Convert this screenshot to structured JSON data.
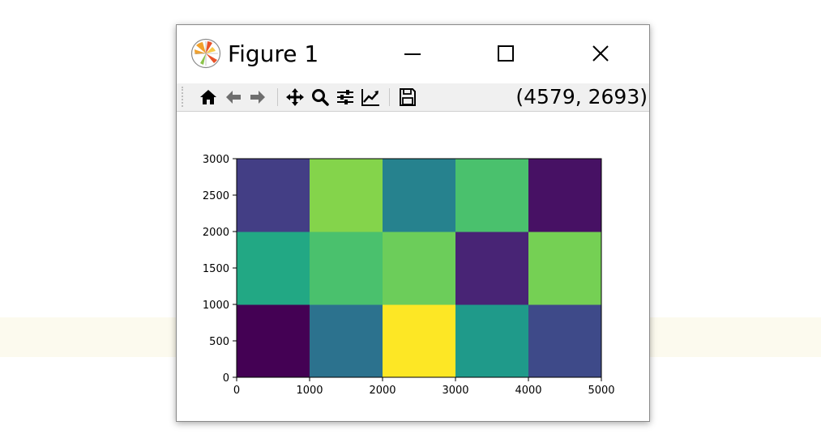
{
  "window": {
    "title": "Figure 1",
    "coordinate_readout": "(4579, 2693)"
  },
  "toolbar": {
    "buttons": [
      {
        "name": "home-icon"
      },
      {
        "name": "back-arrow-icon"
      },
      {
        "name": "forward-arrow-icon"
      },
      {
        "name": "pan-move-icon"
      },
      {
        "name": "zoom-magnifier-icon"
      },
      {
        "name": "subplots-configure-icon"
      },
      {
        "name": "edit-axes-line-icon"
      },
      {
        "name": "save-floppy-icon"
      }
    ]
  },
  "window_controls": [
    {
      "name": "minimize-icon"
    },
    {
      "name": "maximize-icon"
    },
    {
      "name": "close-icon"
    }
  ],
  "colors": {
    "window_bg": "#ffffff",
    "toolbar_bg": "#f0f0f0",
    "page_band": "#fcfaee"
  },
  "chart_data": {
    "type": "heatmap",
    "colormap": "viridis",
    "x_edges": [
      0,
      1000,
      2000,
      3000,
      4000,
      5000
    ],
    "y_edges": [
      0,
      1000,
      2000,
      3000
    ],
    "xlim": [
      0,
      5000
    ],
    "ylim": [
      0,
      3000
    ],
    "x_ticks": [
      "0",
      "1000",
      "2000",
      "3000",
      "4000",
      "5000"
    ],
    "y_ticks": [
      "0",
      "500",
      "1000",
      "1500",
      "2000",
      "2500",
      "3000"
    ],
    "cells_rows_bottom_to_top": [
      [
        "#440154",
        "#2c728e",
        "#fde725",
        "#1f9a8a",
        "#3e4a89"
      ],
      [
        "#22a884",
        "#4ac16d",
        "#6ccd5a",
        "#482475",
        "#75d054"
      ],
      [
        "#433e85",
        "#84d44b",
        "#26828e",
        "#4ac16d",
        "#471164"
      ]
    ],
    "grid": false,
    "title": "",
    "xlabel": "",
    "ylabel": ""
  }
}
